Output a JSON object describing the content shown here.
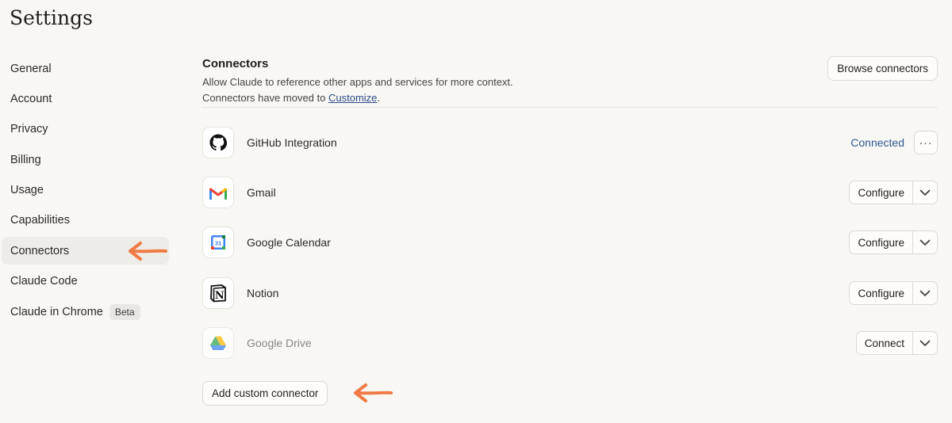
{
  "page": {
    "title": "Settings"
  },
  "sidebar": {
    "items": [
      {
        "label": "General"
      },
      {
        "label": "Account"
      },
      {
        "label": "Privacy"
      },
      {
        "label": "Billing"
      },
      {
        "label": "Usage"
      },
      {
        "label": "Capabilities"
      },
      {
        "label": "Connectors",
        "active": true
      },
      {
        "label": "Claude Code"
      },
      {
        "label": "Claude in Chrome",
        "badge": "Beta"
      }
    ]
  },
  "connectors": {
    "title": "Connectors",
    "description_line1": "Allow Claude to reference other apps and services for more context.",
    "description_line2_prefix": "Connectors have moved to ",
    "description_link": "Customize",
    "description_line2_suffix": ".",
    "browse_label": "Browse connectors",
    "add_custom_label": "Add custom connector",
    "items": [
      {
        "name": "GitHub Integration",
        "icon": "github-icon",
        "status": "Connected",
        "more": "···"
      },
      {
        "name": "Gmail",
        "icon": "gmail-icon",
        "action": "Configure"
      },
      {
        "name": "Google Calendar",
        "icon": "google-calendar-icon",
        "action": "Configure",
        "icon_text": "31"
      },
      {
        "name": "Notion",
        "icon": "notion-icon",
        "action": "Configure",
        "icon_text": "N"
      },
      {
        "name": "Google Drive",
        "icon": "google-drive-icon",
        "action": "Connect"
      }
    ]
  },
  "colors": {
    "accent_arrow": "#f07a45",
    "link": "#2c4d8a",
    "connected": "#2f5a93",
    "background": "#f8f7f4"
  }
}
